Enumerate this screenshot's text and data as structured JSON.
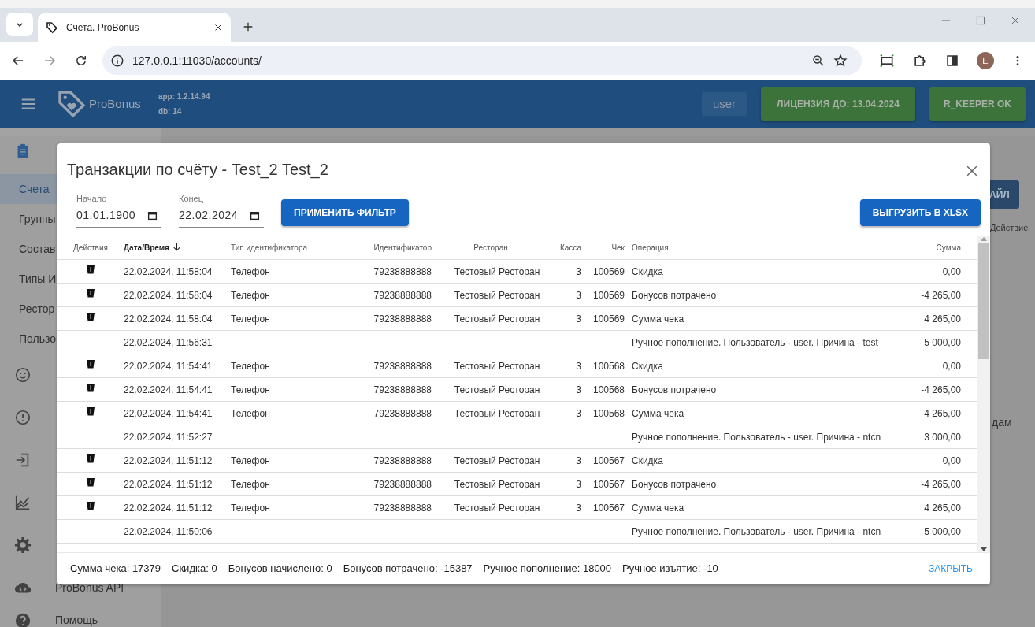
{
  "browser": {
    "tab_title": "Счета. ProBonus",
    "url": "127.0.0.1:11030/accounts/",
    "profile_initial": "E"
  },
  "header": {
    "brand": "ProBonus",
    "app_version": "app: 1.2.14.94",
    "db_version": "db: 14",
    "user": "user",
    "license": "ЛИЦЕНЗИЯ ДО: 13.04.2024",
    "status": "R_KEEPER OK"
  },
  "sidebar": {
    "items": [
      {
        "kind": "group",
        "selected": false
      },
      {
        "kind": "sub",
        "label": "Счета",
        "selected": true
      },
      {
        "kind": "sub",
        "label": "Группы",
        "selected": false
      },
      {
        "kind": "sub",
        "label": "Состав",
        "selected": false
      },
      {
        "kind": "sub",
        "label": "Типы И",
        "selected": false
      },
      {
        "kind": "sub",
        "label": "Рестор",
        "selected": false
      },
      {
        "kind": "sub",
        "label": "Пользо",
        "selected": false
      },
      {
        "kind": "group",
        "selected": false
      },
      {
        "kind": "group",
        "selected": false
      },
      {
        "kind": "group",
        "selected": false
      },
      {
        "kind": "group",
        "selected": false
      },
      {
        "kind": "group",
        "selected": false
      },
      {
        "kind": "group",
        "label": "ProBonus API",
        "selected": false
      },
      {
        "kind": "group",
        "label": "Помощь",
        "selected": false
      }
    ]
  },
  "page": {
    "file_button": "АЙЛ",
    "column_header": "Действие",
    "text_fragment": "дам"
  },
  "dialog": {
    "title": "Транзакции по счёту - Test_2 Test_2",
    "filters": [
      {
        "label": "Начало",
        "value": "01.01.1900"
      },
      {
        "label": "Конец",
        "value": "22.02.2024"
      }
    ],
    "apply_button": "ПРИМЕНИТЬ ФИЛЬТР",
    "export_button": "ВЫГРУЗИТЬ В XLSX",
    "table": {
      "columns": [
        {
          "label": "Действия",
          "sorted": false
        },
        {
          "label": "Дата/Время",
          "sorted": true
        },
        {
          "label": "Тип идентификатора",
          "sorted": false
        },
        {
          "label": "Идентификатор",
          "sorted": false
        },
        {
          "label": "Ресторан",
          "sorted": false
        },
        {
          "label": "Касса",
          "sorted": false
        },
        {
          "label": "Чек",
          "sorted": false
        },
        {
          "label": "Операция",
          "sorted": false
        },
        {
          "label": "Сумма",
          "sorted": false
        }
      ],
      "rows": [
        {
          "has_action": true,
          "cells": [
            "",
            "22.02.2024, 11:58:04",
            "Телефон",
            "79238888888",
            "Тестовый Ресторан",
            "3",
            "100569",
            "Скидка",
            "0,00"
          ]
        },
        {
          "has_action": true,
          "cells": [
            "",
            "22.02.2024, 11:58:04",
            "Телефон",
            "79238888888",
            "Тестовый Ресторан",
            "3",
            "100569",
            "Бонусов потрачено",
            "-4 265,00"
          ]
        },
        {
          "has_action": true,
          "cells": [
            "",
            "22.02.2024, 11:58:04",
            "Телефон",
            "79238888888",
            "Тестовый Ресторан",
            "3",
            "100569",
            "Сумма чека",
            "4 265,00"
          ]
        },
        {
          "has_action": false,
          "cells": [
            "",
            "22.02.2024, 11:56:31",
            "",
            "",
            "",
            "",
            "",
            "Ручное пополнение. Пользователь - user. Причина - test",
            "5 000,00"
          ]
        },
        {
          "has_action": true,
          "cells": [
            "",
            "22.02.2024, 11:54:41",
            "Телефон",
            "79238888888",
            "Тестовый Ресторан",
            "3",
            "100568",
            "Скидка",
            "0,00"
          ]
        },
        {
          "has_action": true,
          "cells": [
            "",
            "22.02.2024, 11:54:41",
            "Телефон",
            "79238888888",
            "Тестовый Ресторан",
            "3",
            "100568",
            "Бонусов потрачено",
            "-4 265,00"
          ]
        },
        {
          "has_action": true,
          "cells": [
            "",
            "22.02.2024, 11:54:41",
            "Телефон",
            "79238888888",
            "Тестовый Ресторан",
            "3",
            "100568",
            "Сумма чека",
            "4 265,00"
          ]
        },
        {
          "has_action": false,
          "cells": [
            "",
            "22.02.2024, 11:52:27",
            "",
            "",
            "",
            "",
            "",
            "Ручное пополнение. Пользователь - user. Причина - ntcn",
            "3 000,00"
          ]
        },
        {
          "has_action": true,
          "cells": [
            "",
            "22.02.2024, 11:51:12",
            "Телефон",
            "79238888888",
            "Тестовый Ресторан",
            "3",
            "100567",
            "Скидка",
            "0,00"
          ]
        },
        {
          "has_action": true,
          "cells": [
            "",
            "22.02.2024, 11:51:12",
            "Телефон",
            "79238888888",
            "Тестовый Ресторан",
            "3",
            "100567",
            "Бонусов потрачено",
            "-4 265,00"
          ]
        },
        {
          "has_action": true,
          "cells": [
            "",
            "22.02.2024, 11:51:12",
            "Телефон",
            "79238888888",
            "Тестовый Ресторан",
            "3",
            "100567",
            "Сумма чека",
            "4 265,00"
          ]
        },
        {
          "has_action": false,
          "cells": [
            "",
            "22.02.2024, 11:50:06",
            "",
            "",
            "",
            "",
            "",
            "Ручное пополнение. Пользователь - user. Причина - ntcn",
            "5 000,00"
          ]
        }
      ]
    },
    "totals": [
      "Сумма чека: 17379",
      "Скидка: 0",
      "Бонусов начислено: 0",
      "Бонусов потрачено: -15387",
      "Ручное пополнение: 18000",
      "Ручное изъятие: -10"
    ],
    "close_button": "ЗАКРЫТЬ"
  }
}
